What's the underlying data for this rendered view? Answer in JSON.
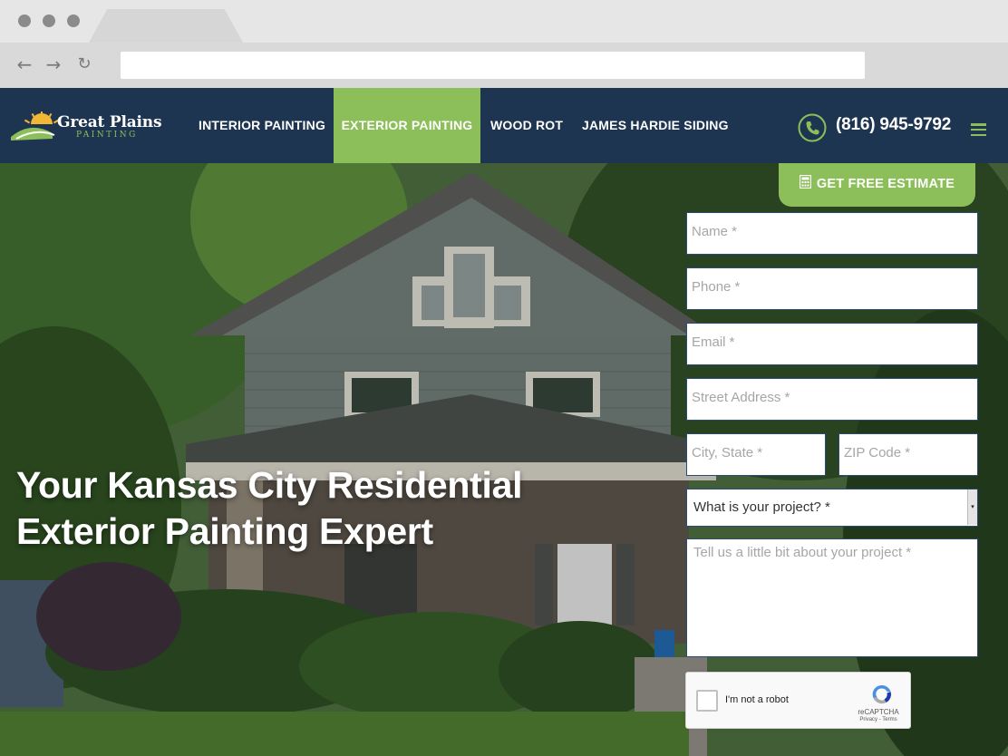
{
  "site": {
    "logo_title": "Great Plains",
    "logo_sub": "PAINTING",
    "nav": [
      {
        "label": "INTERIOR PAINTING"
      },
      {
        "label": "EXTERIOR PAINTING"
      },
      {
        "label": "WOOD ROT"
      },
      {
        "label": "JAMES HARDIE SIDING"
      }
    ],
    "phone": "(816) 945-9792"
  },
  "hero": {
    "title_line1": "Your Kansas City Residential",
    "title_line2": "Exterior Painting Expert"
  },
  "form": {
    "button": "GET FREE ESTIMATE",
    "name": "Name *",
    "phone": "Phone *",
    "email": "Email *",
    "street": "Street Address *",
    "city": "City, State *",
    "zip": "ZIP Code *",
    "project_select": "What is your project? *",
    "details": "Tell us a little bit about your project *"
  },
  "recaptcha": {
    "label": "I'm not a robot",
    "brand": "reCAPTCHA",
    "links": "Privacy - Terms"
  },
  "colors": {
    "navy": "#1e3551",
    "green": "#8cbf5a"
  }
}
